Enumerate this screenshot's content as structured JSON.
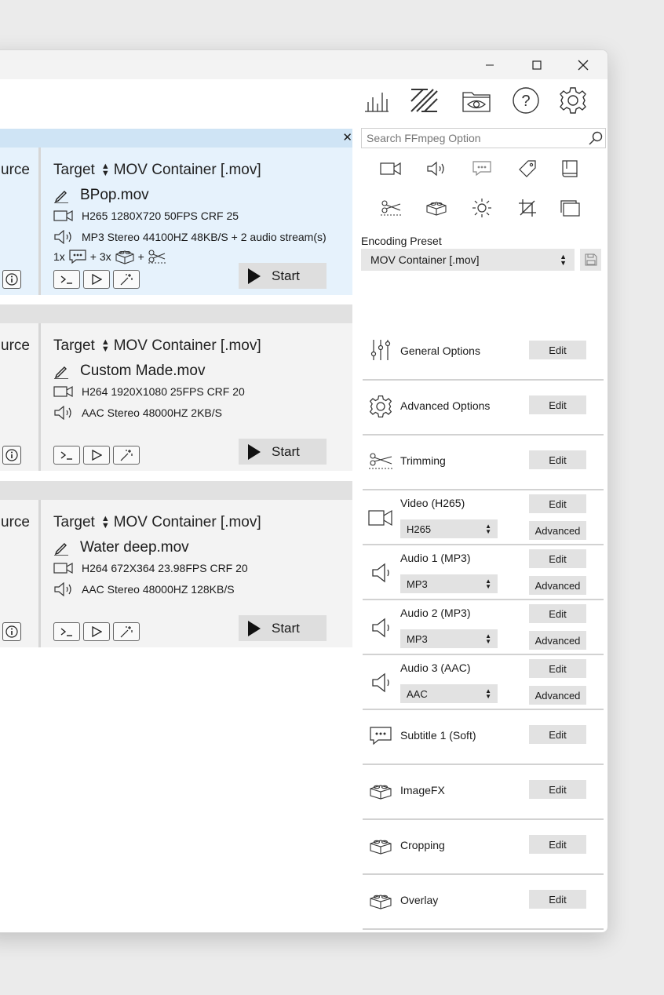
{
  "window": {
    "controls": {
      "minimize": "minimize",
      "maximize": "maximize",
      "close": "close"
    }
  },
  "toolbar": {
    "icons": [
      "stats-icon",
      "encode-icon",
      "preview-folder-icon",
      "help-icon",
      "settings-icon"
    ]
  },
  "queue": {
    "close_symbol": "✕",
    "jobs": [
      {
        "source_label": "urce",
        "target_label": "Target",
        "container": "MOV Container [.mov]",
        "filename": "BPop.mov",
        "video": "H265 1280X720 50FPS CRF 25",
        "audio": "MP3 Stereo 44100HZ 48KB/S + 2 audio stream(s)",
        "extras": {
          "sub_count": "1x",
          "plus1": "+ 3x",
          "plus2": "+"
        },
        "start_label": "Start",
        "selected": true
      },
      {
        "source_label": "urce",
        "target_label": "Target",
        "container": "MOV Container [.mov]",
        "filename": "Custom Made.mov",
        "video": "H264 1920X1080 25FPS CRF 20",
        "audio": "AAC Stereo 48000HZ 2KB/S",
        "start_label": "Start",
        "selected": false
      },
      {
        "source_label": "urce",
        "target_label": "Target",
        "container": "MOV Container [.mov]",
        "filename": "Water deep.mov",
        "video": "H264 672X364 23.98FPS CRF 20",
        "audio": "AAC Stereo 48000HZ 128KB/S",
        "start_label": "Start",
        "selected": false
      }
    ]
  },
  "panel": {
    "search_placeholder": "Search FFmpeg Option",
    "preset_label": "Encoding Preset",
    "preset_value": "MOV Container [.mov]",
    "options": [
      {
        "label": "General Options",
        "edit": "Edit"
      },
      {
        "label": "Advanced Options",
        "edit": "Edit"
      },
      {
        "label": "Trimming",
        "edit": "Edit"
      },
      {
        "label": "Video (H265)",
        "edit": "Edit",
        "codec": "H265",
        "advanced": "Advanced"
      },
      {
        "label": "Audio 1 (MP3)",
        "edit": "Edit",
        "codec": "MP3",
        "advanced": "Advanced"
      },
      {
        "label": "Audio 2 (MP3)",
        "edit": "Edit",
        "codec": "MP3",
        "advanced": "Advanced"
      },
      {
        "label": "Audio 3 (AAC)",
        "edit": "Edit",
        "codec": "AAC",
        "advanced": "Advanced"
      },
      {
        "label": "Subtitle 1 (Soft)",
        "edit": "Edit"
      },
      {
        "label": "ImageFX",
        "edit": "Edit"
      },
      {
        "label": "Cropping",
        "edit": "Edit"
      },
      {
        "label": "Overlay",
        "edit": "Edit"
      }
    ]
  },
  "colors": {
    "selected_bg": "#e6f2fc",
    "selected_header": "#cfe4f5",
    "job_bg": "#f3f3f3",
    "header_bg": "#e1e1e1"
  }
}
